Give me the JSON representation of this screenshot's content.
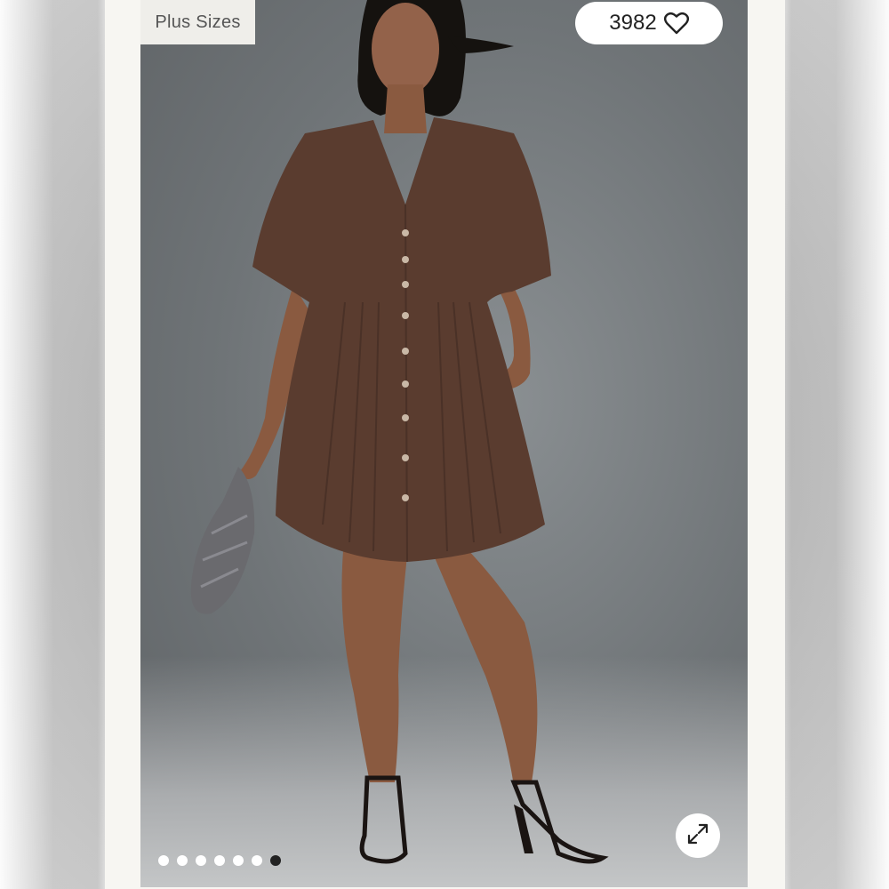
{
  "badge": {
    "label": "Plus Sizes"
  },
  "likes": {
    "count": "3982",
    "icon": "heart-icon"
  },
  "expand": {
    "icon": "expand-icon"
  },
  "carousel": {
    "total": 7,
    "active_index": 6
  },
  "colors": {
    "dress": "#5a3c2f",
    "skin": "#8a5a40",
    "bag": "#6a6a6e",
    "background": "#727679"
  }
}
